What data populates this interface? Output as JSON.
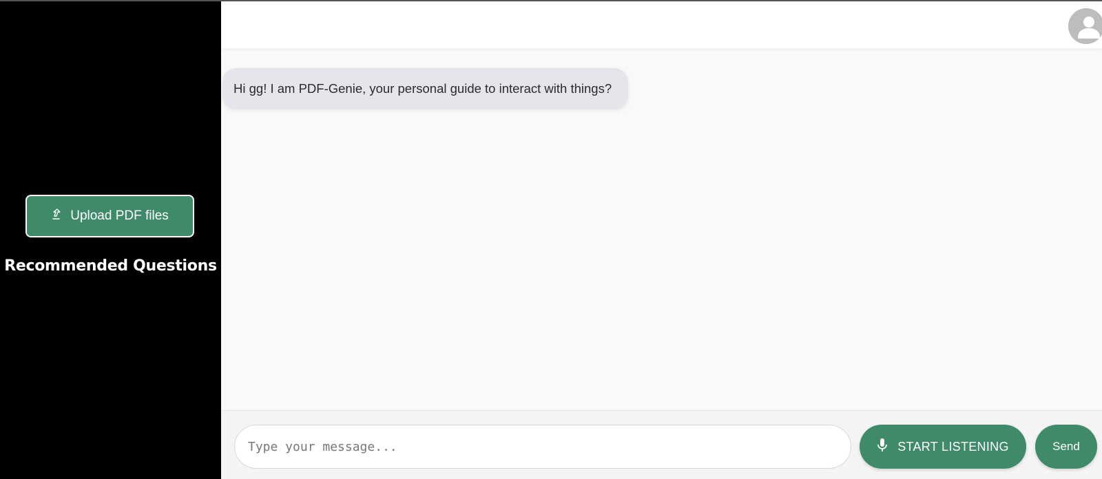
{
  "sidebar": {
    "upload_label": "Upload PDF files",
    "upload_icon": "upload-icon",
    "recommended_title": "Recommended Questions"
  },
  "header": {
    "avatar_icon": "user-avatar-icon"
  },
  "chat": {
    "messages": [
      {
        "sender": "bot",
        "text": "Hi gg! I am PDF-Genie, your personal guide to interact with things?"
      }
    ]
  },
  "composer": {
    "placeholder": "Type your message...",
    "value": "",
    "listen_label": "START LISTENING",
    "listen_icon": "microphone-icon",
    "send_label": "Send"
  },
  "colors": {
    "accent": "#3f8b69",
    "sidebar_bg": "#000000",
    "bubble_bg": "#e5e6eb"
  }
}
